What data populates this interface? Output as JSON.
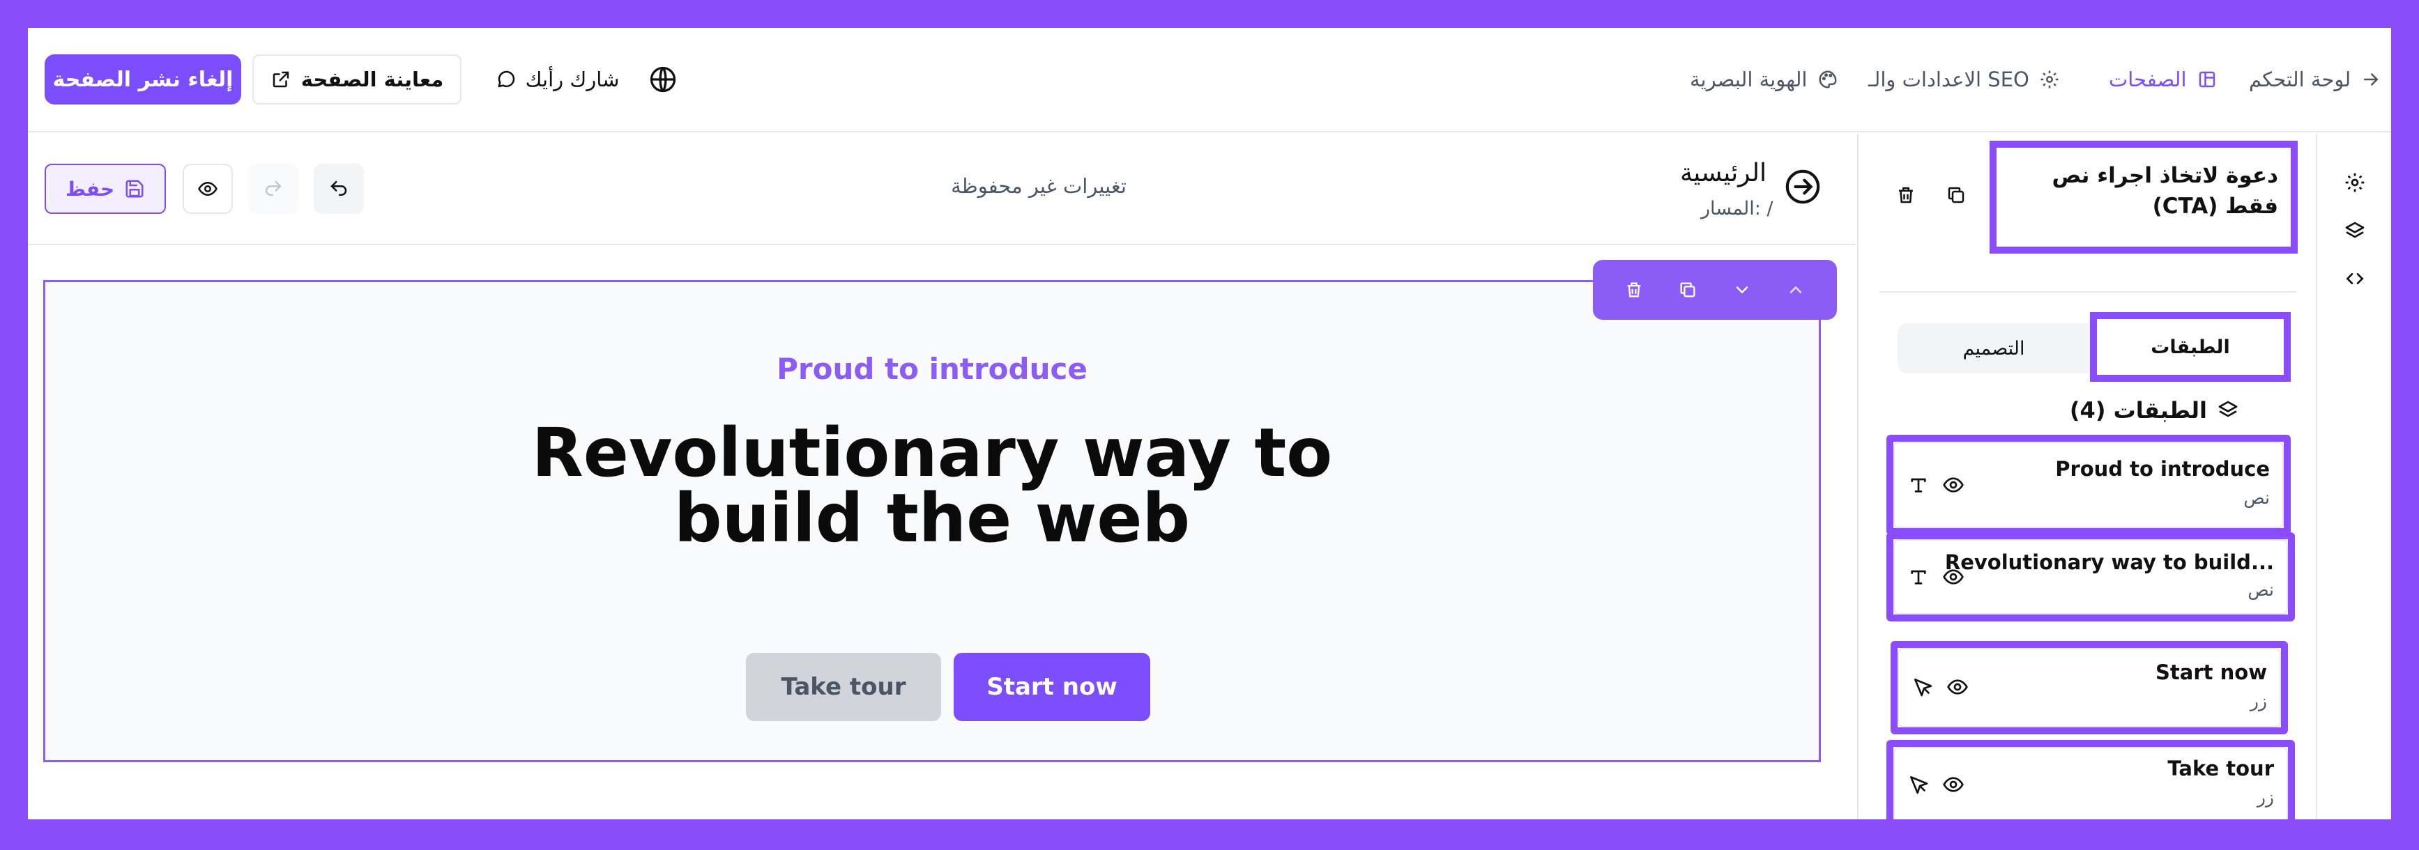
{
  "colors": {
    "accent": "#7c4dfb",
    "highlight": "#8b4dfb",
    "canvas_border": "#8b5cf6"
  },
  "topbar": {
    "unpublish_label": "إلغاء نشر الصفحة",
    "preview_label": "معاينة الصفحة",
    "feedback_label": "شارك رأيك",
    "nav": {
      "dashboard": "لوحة التحكم",
      "pages": "الصفحات",
      "settings_seo": "الاعدادات والـ SEO",
      "branding": "الهوية البصرية"
    }
  },
  "editor": {
    "save_label": "حفظ",
    "unsaved_status": "تغييرات غير محفوظة",
    "page_name": "الرئيسية",
    "page_path": "المسار: /"
  },
  "canvas": {
    "eyebrow": "Proud to introduce",
    "headline_line1": "Revolutionary way to",
    "headline_line2": "build the web",
    "primary_button": "Start now",
    "secondary_button": "Take tour"
  },
  "panel": {
    "block_title": "دعوة لاتخاذ اجراء نص فقط (CTA)",
    "tab_layers": "الطبقات",
    "tab_design": "التصميم",
    "layers_heading": "الطبقات (4)",
    "layers": [
      {
        "name": "Proud to introduce",
        "type": "نص",
        "icon": "text-icon"
      },
      {
        "name": "Revolutionary way to build...",
        "type": "نص",
        "icon": "text-icon"
      },
      {
        "name": "Start now",
        "type": "زر",
        "icon": "cursor-icon"
      },
      {
        "name": "Take tour",
        "type": "زر",
        "icon": "cursor-icon"
      }
    ]
  }
}
